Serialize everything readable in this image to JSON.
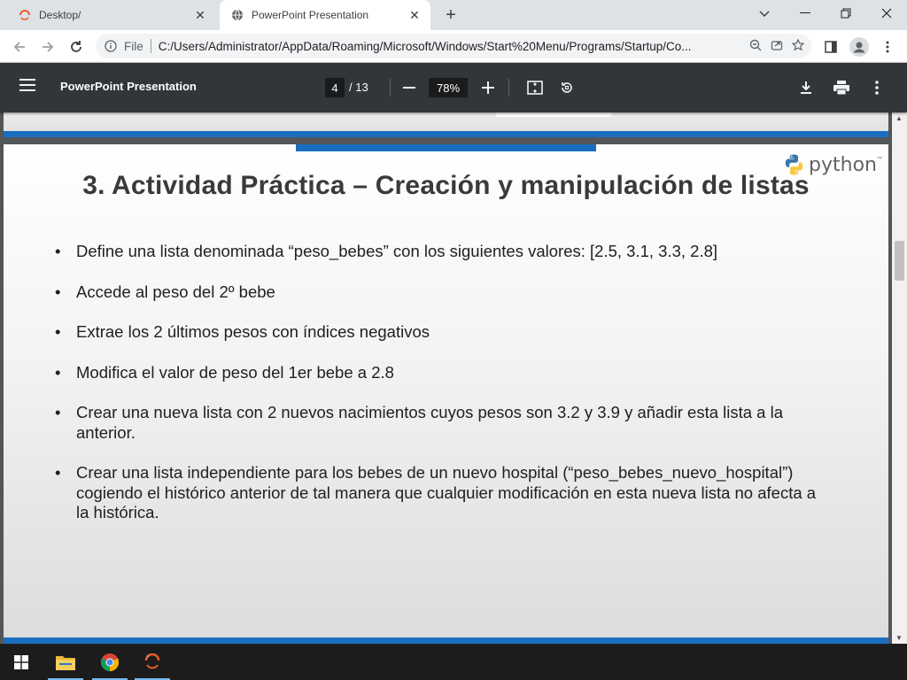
{
  "browser": {
    "tabs": [
      {
        "title": "Desktop/",
        "active": false
      },
      {
        "title": "PowerPoint Presentation",
        "active": true
      }
    ],
    "address": {
      "scheme_label": "File",
      "url": "C:/Users/Administrator/AppData/Roaming/Microsoft/Windows/Start%20Menu/Programs/Startup/Co..."
    }
  },
  "pdf_viewer": {
    "doc_title": "PowerPoint Presentation",
    "current_page": "4",
    "total_pages": "/ 13",
    "zoom": "78%"
  },
  "slide": {
    "title": "3. Actividad Práctica – Creación y manipulación de listas",
    "logo_text": "python",
    "logo_tm": "™",
    "bullets": [
      "Define una lista denominada “peso_bebes” con los siguientes valores: [2.5, 3.1, 3.3, 2.8]",
      "Accede al peso del 2º bebe",
      "Extrae los 2 últimos pesos con índices negativos",
      "Modifica el valor de peso del 1er bebe a 2.8",
      "Crear una nueva lista con 2 nuevos nacimientos cuyos pesos son 3.2 y 3.9 y añadir esta lista a la anterior.",
      "Crear una lista independiente para los bebes de un nuevo hospital (“peso_bebes_nuevo_hospital”) cogiendo el histórico anterior de tal manera que cualquier modificación en esta nueva lista no afecta a la histórica."
    ]
  },
  "colors": {
    "slide_accent": "#1a6ec0",
    "pdf_toolbar": "#323639",
    "viewer_bg": "#525659"
  }
}
